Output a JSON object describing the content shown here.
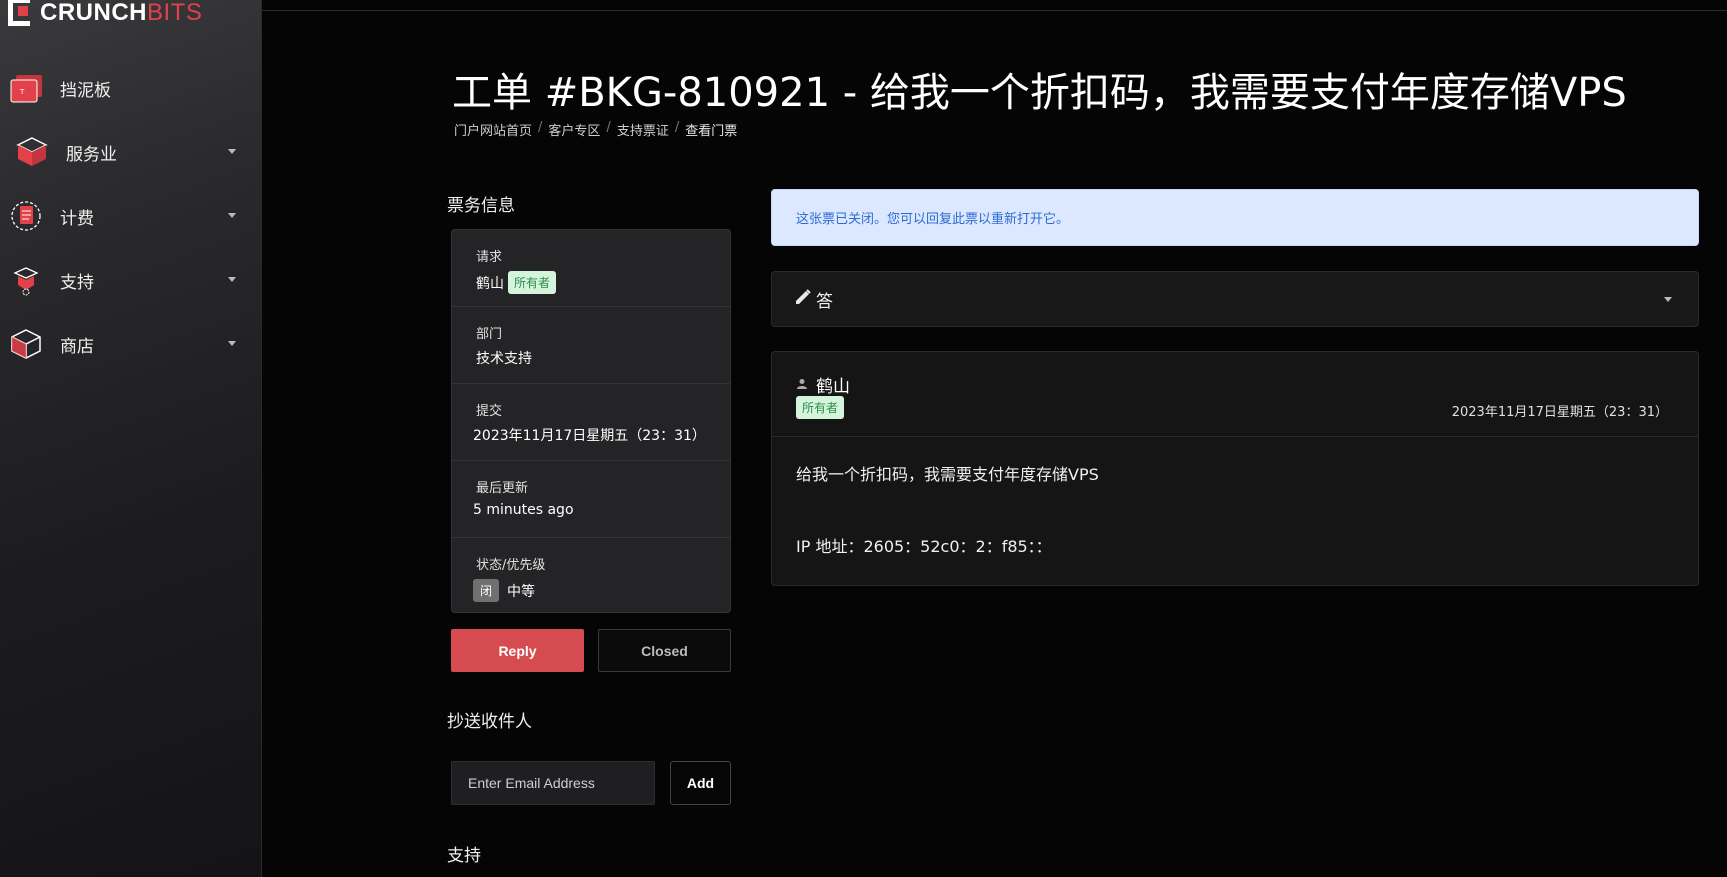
{
  "logo": {
    "brand": "CRUNCH",
    "brand_accent": "BITS"
  },
  "sidebar": {
    "items": [
      {
        "label": "挡泥板",
        "icon": "dashboard-icon",
        "has_caret": false
      },
      {
        "label": "服务业",
        "icon": "services-box-icon",
        "has_caret": true
      },
      {
        "label": "计费",
        "icon": "billing-icon",
        "has_caret": true
      },
      {
        "label": "支持",
        "icon": "support-icon",
        "has_caret": true
      },
      {
        "label": "商店",
        "icon": "store-box-icon",
        "has_caret": true
      }
    ]
  },
  "page": {
    "title": "工单 #BKG-810921 - 给我一个折扣码，我需要支付年度存储VPS",
    "breadcrumb": [
      "门户网站首页",
      "客户专区",
      "支持票证",
      "查看门票"
    ]
  },
  "ticket_info": {
    "section_title": "票务信息",
    "requestor_label": "请求",
    "requestor_name": "鹤山",
    "requestor_badge": "所有者",
    "department_label": "部门",
    "department_value": "技术支持",
    "submitted_label": "提交",
    "submitted_value": "2023年11月17日星期五（23：31）",
    "updated_label": "最后更新",
    "updated_value": "5 minutes ago",
    "status_label": "状态/优先级",
    "status_badge": "闭",
    "priority_value": "中等"
  },
  "actions": {
    "reply_label": "Reply",
    "closed_label": "Closed"
  },
  "cc": {
    "section_title": "抄送收件人",
    "email_placeholder": "Enter Email Address",
    "add_label": "Add"
  },
  "support_section_title": "支持",
  "alert": {
    "text": "这张票已关闭。您可以回复此票以重新打开它。"
  },
  "reply_bar": {
    "label": "答"
  },
  "message": {
    "author": "鹤山",
    "author_badge": "所有者",
    "date": "2023年11月17日星期五（23：31）",
    "line1": "给我一个折扣码，我需要支付年度存储VPS",
    "line2": "IP 地址：2605：52c0：2：f85：："
  },
  "colors": {
    "accent": "#d54b4f",
    "brand_red": "#e3414a",
    "alert_bg": "#dce8ff",
    "owner_badge_bg": "#d4f5dc"
  }
}
